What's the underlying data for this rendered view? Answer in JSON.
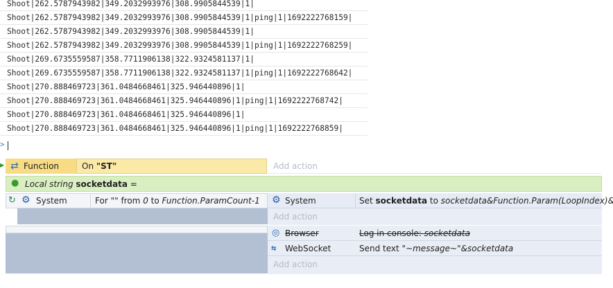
{
  "console": {
    "lines": [
      "Shoot|262.5787943982|349.2032993976|308.9905844539|1|",
      "Shoot|262.5787943982|349.2032993976|308.9905844539|1|ping|1|1692222768159|",
      "Shoot|262.5787943982|349.2032993976|308.9905844539|1|",
      "Shoot|262.5787943982|349.2032993976|308.9905844539|1|ping|1|1692222768259|",
      "Shoot|269.6735559587|358.7711906138|322.9324581137|1|",
      "Shoot|269.6735559587|358.7711906138|322.9324581137|1|ping|1|1692222768642|",
      "Shoot|270.888469723|361.0484668461|325.946440896|1|",
      "Shoot|270.888469723|361.0484668461|325.946440896|1|ping|1|1692222768742|",
      "Shoot|270.888469723|361.0484668461|325.946440896|1|",
      "Shoot|270.888469723|361.0484668461|325.946440896|1|ping|1|1692222768859|"
    ],
    "prompt": ">"
  },
  "function_event": {
    "object": "Function",
    "condition_prefix": "On ",
    "condition_name": "\"ST\"",
    "add_action": "Add action"
  },
  "local_var": {
    "prefix": "Local string ",
    "name": "socketdata",
    "suffix": " ="
  },
  "loop_event": {
    "object": "System",
    "cond_for": "For ",
    "cond_name": "\"\"",
    "cond_from": " from ",
    "cond_start": "0",
    "cond_to": " to ",
    "cond_end": "Function.ParamCount-1",
    "action": {
      "object": "System",
      "set": "Set ",
      "var": "socketdata",
      "to": " to ",
      "expr": "socketdata&Function.Param(LoopIndex)&",
      "suffix": "\"|\""
    },
    "add_action": "Add action"
  },
  "send_event": {
    "actions": [
      {
        "object": "Browser",
        "text": "Log in console: ",
        "param": "socketdata"
      },
      {
        "object": "WebSocket",
        "text": "Send text ",
        "param": "\"~message~\"&socketdata"
      }
    ],
    "add_action": "Add action"
  },
  "colors": {
    "function_bg": "#fbe9a7",
    "local_var_bg": "#d9efc2",
    "action_bg": "#e9edf5",
    "sub_body_bg": "#b3c0d4"
  },
  "icons": [
    "function-icon",
    "pin-icon",
    "loop-icon",
    "gear-icon",
    "browser-icon",
    "websocket-icon"
  ]
}
